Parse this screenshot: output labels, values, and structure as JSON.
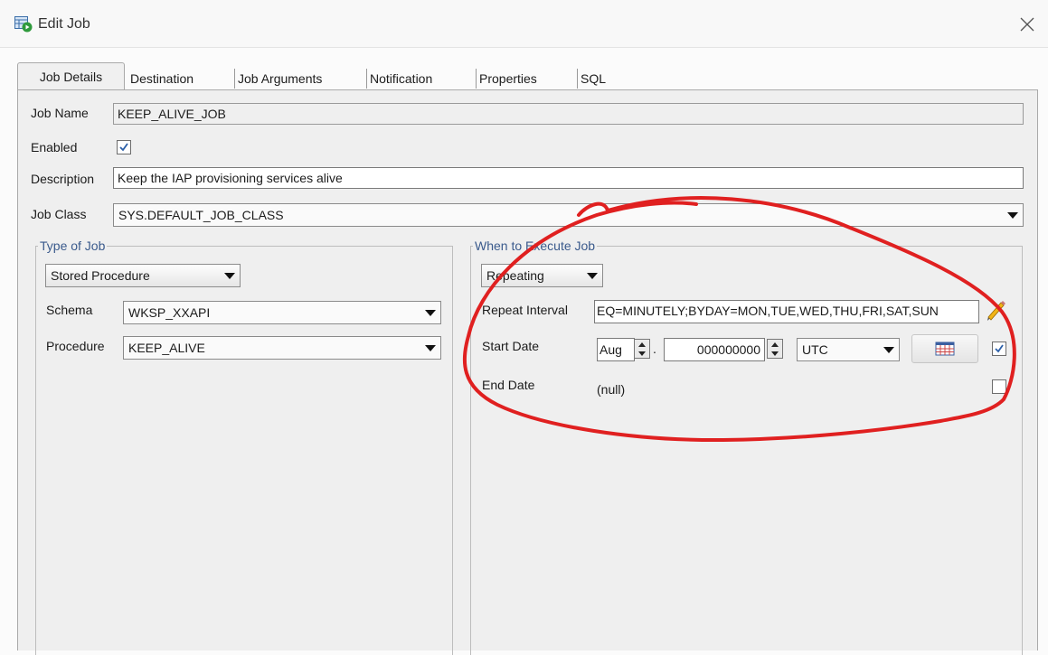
{
  "window": {
    "title": "Edit Job"
  },
  "tabs": [
    "Job Details",
    "Destination",
    "Job Arguments",
    "Notification",
    "Properties",
    "SQL"
  ],
  "form": {
    "job_name_label": "Job Name",
    "job_name_value": "KEEP_ALIVE_JOB",
    "enabled_label": "Enabled",
    "enabled_checked": true,
    "description_label": "Description",
    "description_value": "Keep the IAP provisioning services alive",
    "job_class_label": "Job Class",
    "job_class_value": "SYS.DEFAULT_JOB_CLASS"
  },
  "type_of_job": {
    "legend": "Type of Job",
    "type_value": "Stored Procedure",
    "schema_label": "Schema",
    "schema_value": "WKSP_XXAPI",
    "procedure_label": "Procedure",
    "procedure_value": "KEEP_ALIVE"
  },
  "when_to_execute": {
    "legend": "When to Execute Job",
    "mode_value": "Repeating",
    "repeat_interval_label": "Repeat Interval",
    "repeat_interval_value": "EQ=MINUTELY;BYDAY=MON,TUE,WED,THU,FRI,SAT,SUN",
    "start_date_label": "Start Date",
    "start_month_value": "Aug",
    "start_nanos_value": "000000000",
    "timezone_value": "UTC",
    "start_date_checked": true,
    "end_date_label": "End Date",
    "end_date_value": "(null)",
    "end_date_checked": false
  },
  "colors": {
    "annotation": "#e02020",
    "legend_text": "#3a5a8c",
    "checkmark": "#2b5fa8"
  }
}
